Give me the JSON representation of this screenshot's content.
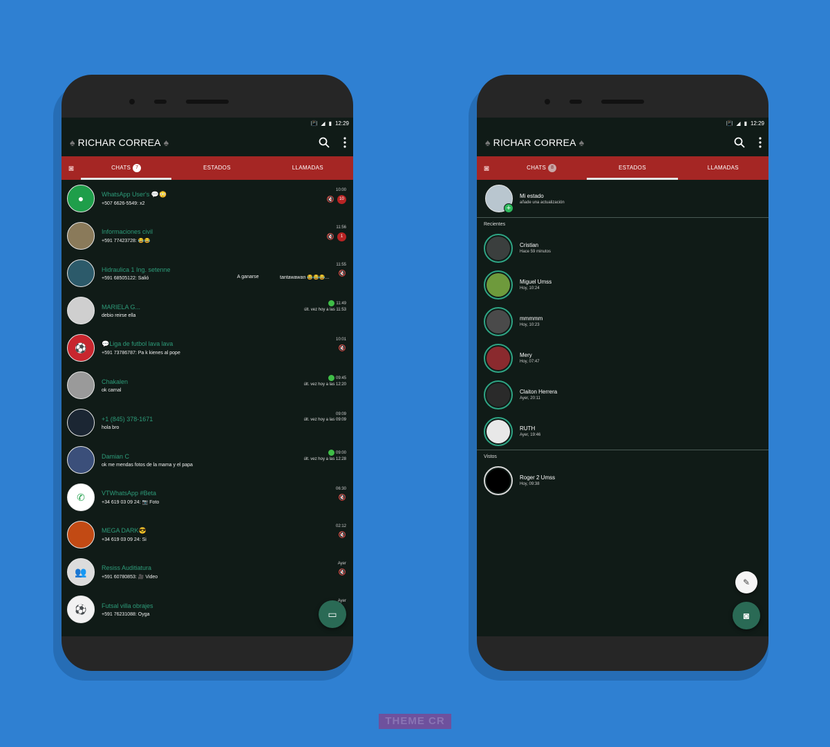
{
  "header": {
    "title": "RICHAR CORREA",
    "time": "12:29",
    "signal": "LTE"
  },
  "tabs": {
    "chats": "CHATS",
    "chats_badge": "7",
    "estados": "ESTADOS",
    "llamadas": "LLAMADAS",
    "estados_badge": "8"
  },
  "chats": [
    {
      "name": "WhatsApp User's 💬😳",
      "msg": "+507 6626-5549: x2",
      "time": "10:00",
      "unread": "10",
      "muted": true
    },
    {
      "name": "Informaciones civil",
      "msg": "+591 77423728: 😂😂",
      "time": "11:56",
      "unread": "1",
      "muted": true
    },
    {
      "name": "Hidraulica 1 Ing. setenne",
      "msg": "+591 68505122: Salió",
      "mid": "A ganarse",
      "mid2": "tantawawan 😂😂😂...",
      "time": "11:55",
      "muted": true
    },
    {
      "name": "MARIELA G...",
      "msg": "debio reirse ella",
      "time": "11:49",
      "lastseen": "últ. vez hoy a las 11:53",
      "online": true
    },
    {
      "name": "💬Liga de futbol lava lava",
      "msg": "+591 73786787: Pa k kienes al pope",
      "time": "10:01",
      "muted": true
    },
    {
      "name": "Chakalen",
      "msg": "ok carnal",
      "time": "09:45",
      "lastseen": "últ. vez hoy a las 12:20",
      "online": true
    },
    {
      "name": "+1 (845) 378-1671",
      "msg": "hola bro",
      "time": "09:09",
      "lastseen": "últ. vez hoy a las 09:09"
    },
    {
      "name": "Damian C",
      "msg": "ok me mendas fotos de la mama y el papa",
      "time": "09:00",
      "lastseen": "últ. vez hoy a las 12:28",
      "online": true
    },
    {
      "name": "VTWhatsApp #Beta",
      "msg": "+34 619 03 09 24: 📷 Foto",
      "time": "06:30",
      "muted": true
    },
    {
      "name": "MEGA DARK😎",
      "msg": "+34 619 03 09 24: Si",
      "time": "02:12",
      "muted": true
    },
    {
      "name": "Resiss Auditiatura",
      "msg": "+591 60780853: 🎥 Video",
      "time": "Ayer",
      "muted": true
    },
    {
      "name": "Futsal villa obrajes",
      "msg": "+591 76231088: Oyga",
      "time": "Ayer"
    }
  ],
  "status": {
    "my_title": "Mi estado",
    "my_sub": "añade una actualización",
    "recent_label": "Recientes",
    "seen_label": "Vistos",
    "recent": [
      {
        "name": "Cristian",
        "time": "Hace 59 minutos"
      },
      {
        "name": "Miguel Umss",
        "time": "Hoy, 10:24"
      },
      {
        "name": "mmmmm",
        "time": "Hoy, 10:23"
      },
      {
        "name": "Mery",
        "time": "Hoy, 07:47"
      },
      {
        "name": "Claiton Herrera",
        "time": "Ayer, 20:11"
      },
      {
        "name": "RUTH",
        "time": "Ayer, 19:46"
      }
    ],
    "seen": [
      {
        "name": "Roger 2 Umss",
        "time": "Hoy, 09:38"
      }
    ]
  },
  "watermark": "THEME CR",
  "colors": {
    "background": "#2f80d2",
    "screen": "#101b17",
    "tabbar": "#a52624",
    "chat_name": "#2d9b79",
    "fab": "#2a6a55",
    "status_ring": "#2fa585"
  }
}
